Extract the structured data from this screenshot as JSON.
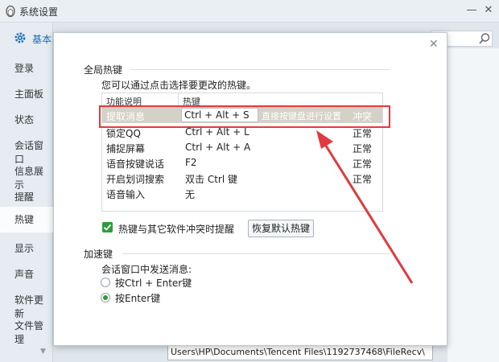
{
  "window": {
    "title": "系统设置"
  },
  "sidebar": {
    "header": "基本",
    "items": [
      {
        "label": "登录"
      },
      {
        "label": "主面板"
      },
      {
        "label": "状态"
      },
      {
        "label": "会话窗口"
      },
      {
        "label": "信息展示"
      },
      {
        "label": "提醒"
      },
      {
        "label": "热键"
      },
      {
        "label": "显示"
      },
      {
        "label": "声音"
      },
      {
        "label": "软件更新"
      },
      {
        "label": "文件管理"
      }
    ],
    "active": "热键"
  },
  "background": {
    "path_value": "Users\\HP\\Documents\\Tencent Files\\1192737468\\FileRecv\\"
  },
  "dialog": {
    "global_hotkeys": {
      "title": "全局热键",
      "hint": "您可以通过点击选择要更改的热键。",
      "columns": [
        "功能说明",
        "热键"
      ],
      "rows": [
        {
          "func": "提取消息",
          "key": "Ctrl + Alt + S",
          "hint": "直接按键盘进行设置",
          "status": "冲突",
          "selected": true
        },
        {
          "func": "锁定QQ",
          "key": "Ctrl + Alt + L",
          "status": "正常"
        },
        {
          "func": "捕捉屏幕",
          "key": "Ctrl + Alt + A",
          "status": "正常"
        },
        {
          "func": "语音按键说话",
          "key": "F2",
          "status": "正常"
        },
        {
          "func": "开启划词搜索",
          "key": "双击 Ctrl 键",
          "status": "正常"
        },
        {
          "func": "语音输入",
          "key": "无",
          "status": ""
        }
      ],
      "conflict_checkbox": "热键与其它软件冲突时提醒",
      "restore_button": "恢复默认热键"
    },
    "accelerator": {
      "title": "加速键",
      "send_label": "会话窗口中发送消息:",
      "options": [
        {
          "label": "按Ctrl + Enter键",
          "checked": false
        },
        {
          "label": "按Enter键",
          "checked": true
        }
      ]
    }
  },
  "colors": {
    "accent": "#1a6fb5",
    "highlight": "#e03a3f",
    "check": "#2f9b3c",
    "selected_row": "#d4d1c6"
  }
}
